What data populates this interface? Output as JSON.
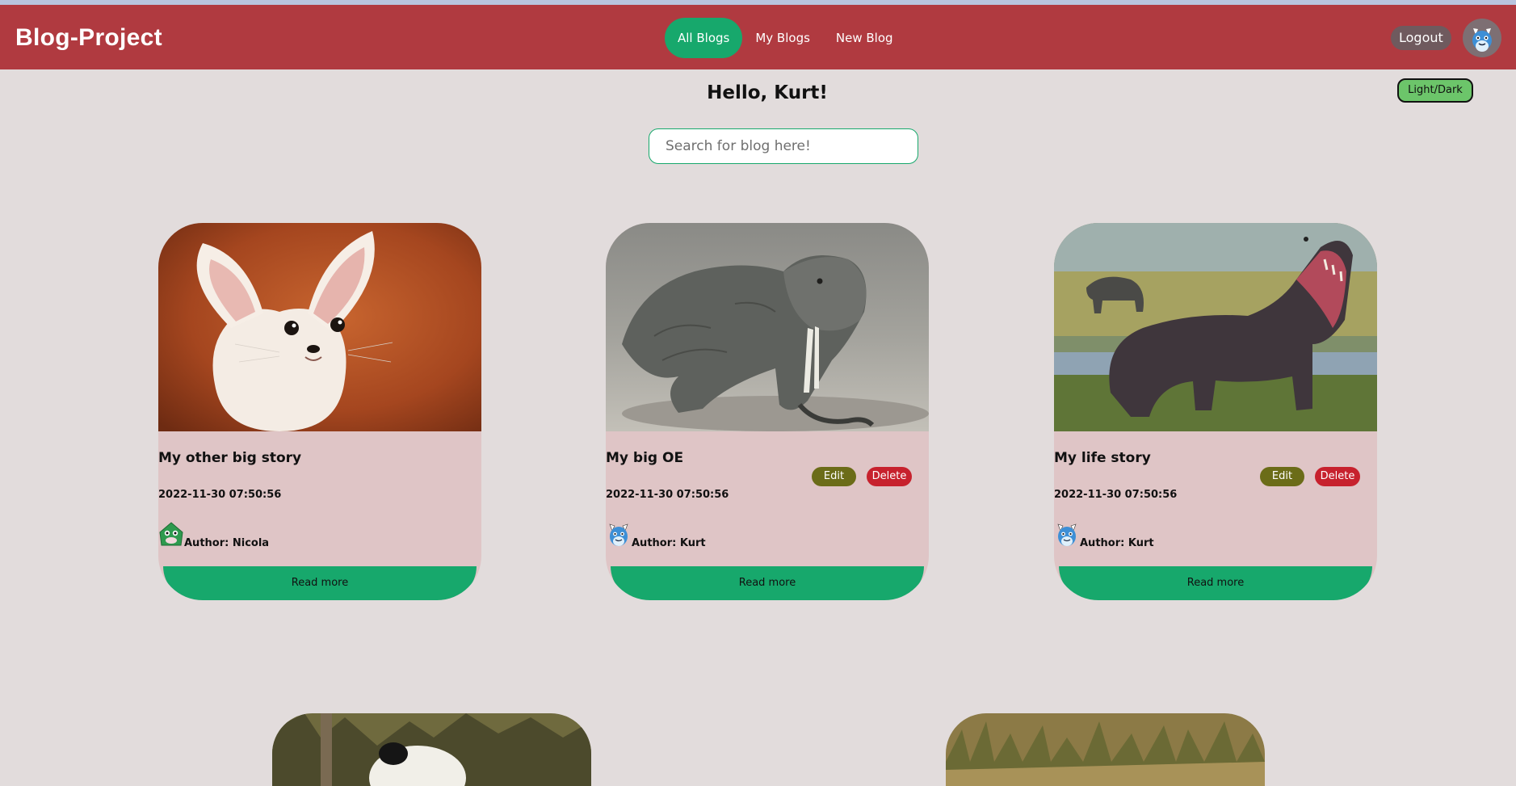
{
  "app": {
    "brand": "Blog-Project"
  },
  "nav": {
    "items": [
      {
        "label": "All Blogs",
        "active": true
      },
      {
        "label": "My Blogs",
        "active": false
      },
      {
        "label": "New Blog",
        "active": false
      }
    ]
  },
  "header": {
    "logout_label": "Logout",
    "theme_toggle_label": "Light/Dark"
  },
  "main": {
    "greeting": "Hello, Kurt!",
    "search": {
      "placeholder": "Search for blog here!",
      "value": ""
    },
    "cards": [
      {
        "title": "My other big story",
        "date": "2022-11-30 07:50:56",
        "author": "Author: Nicola",
        "image": "fennec-fox-photo",
        "author_avatar": "green-monster-avatar-icon",
        "edit_label": "",
        "delete_label": "",
        "read_more": "Read more"
      },
      {
        "title": "My big OE",
        "date": "2022-11-30 07:50:56",
        "author": "Author: Kurt",
        "image": "komodo-dragon-photo",
        "author_avatar": "blue-monster-avatar-icon",
        "edit_label": "Edit",
        "delete_label": "Delete",
        "read_more": "Read more"
      },
      {
        "title": "My life story",
        "date": "2022-11-30 07:50:56",
        "author": "Author: Kurt",
        "image": "hippopotamus-photo",
        "author_avatar": "blue-monster-avatar-icon",
        "edit_label": "Edit",
        "delete_label": "Delete",
        "read_more": "Read more"
      }
    ]
  },
  "colors": {
    "navbar": "#b03a40",
    "accent": "#17a86c",
    "card_body": "#dfc5c6",
    "edit": "#6b6c18",
    "delete": "#c7212d",
    "page_bg": "#e2dcdc"
  }
}
